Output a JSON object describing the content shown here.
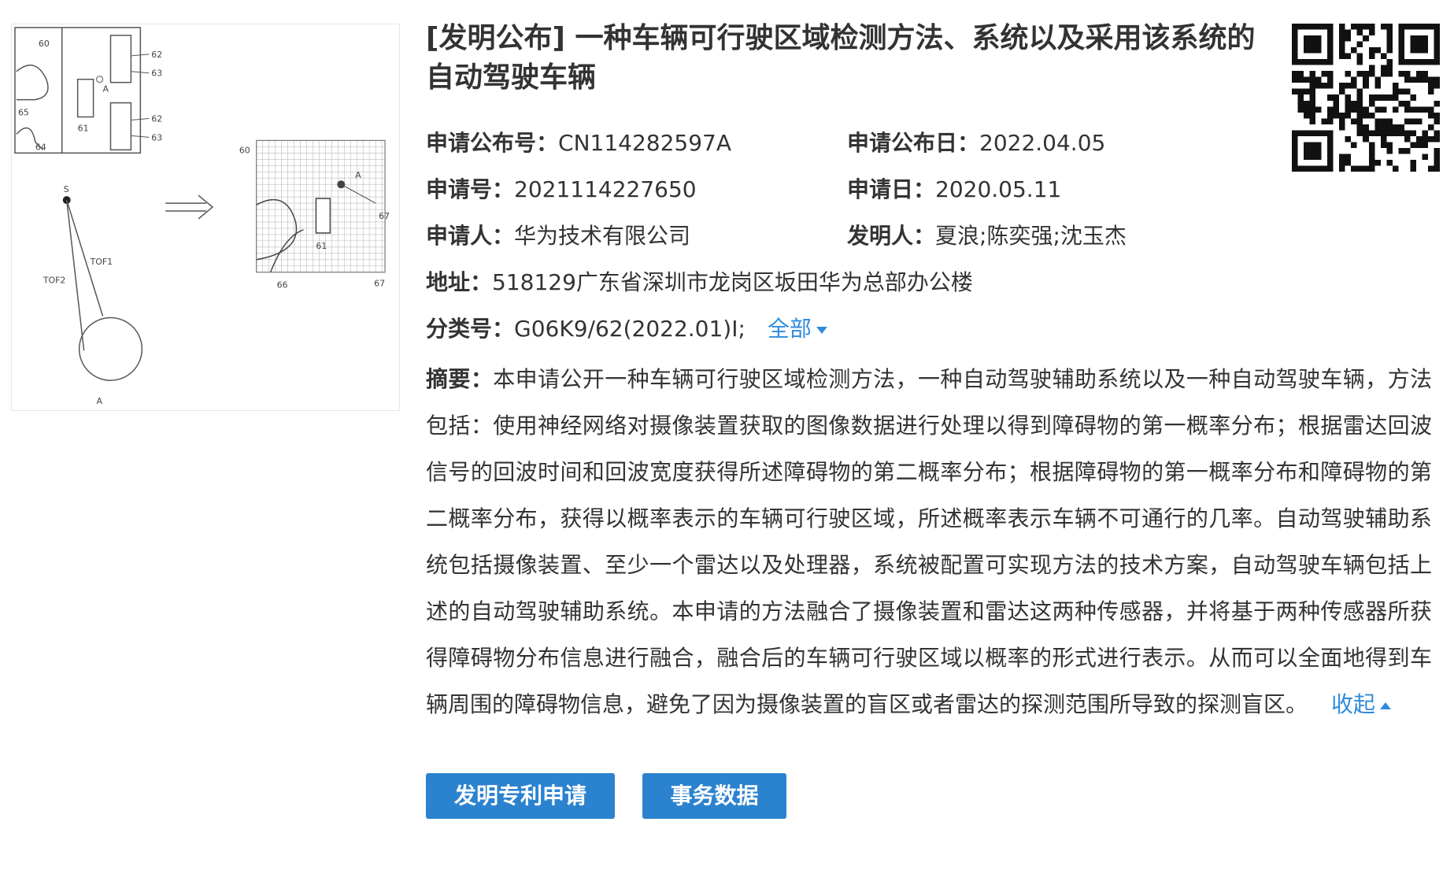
{
  "patent": {
    "title": "[发明公布] 一种车辆可行驶区域检测方法、系统以及采用该系统的自动驾驶车辆",
    "pub_no_label": "申请公布号：",
    "pub_no": "CN114282597A",
    "pub_date_label": "申请公布日：",
    "pub_date": "2022.04.05",
    "app_no_label": "申请号：",
    "app_no": "2021114227650",
    "app_date_label": "申请日：",
    "app_date": "2020.05.11",
    "applicant_label": "申请人：",
    "applicant": "华为技术有限公司",
    "inventor_label": "发明人：",
    "inventor": "夏浪;陈奕强;沈玉杰",
    "address_label": "地址：",
    "address": "518129广东省深圳市龙岗区坂田华为总部办公楼",
    "class_label": "分类号：",
    "class_value": "G06K9/62(2022.01)I;",
    "class_more": "全部",
    "abstract_label": "摘要：",
    "abstract": "本申请公开一种车辆可行驶区域检测方法，一种自动驾驶辅助系统以及一种自动驾驶车辆，方法包括：使用神经网络对摄像装置获取的图像数据进行处理以得到障碍物的第一概率分布；根据雷达回波信号的回波时间和回波宽度获得所述障碍物的第二概率分布；根据障碍物的第一概率分布和障碍物的第二概率分布，获得以概率表示的车辆可行驶区域，所述概率表示车辆不可通行的几率。自动驾驶辅助系统包括摄像装置、至少一个雷达以及处理器，系统被配置可实现方法的技术方案，自动驾驶车辆包括上述的自动驾驶辅助系统。本申请的方法融合了摄像装置和雷达这两种传感器，并将基于两种传感器所获得障碍物分布信息进行融合，融合后的车辆可行驶区域以概率的形式进行表示。从而可以全面地得到车辆周围的障碍物信息，避免了因为摄像装置的盲区或者雷达的探测范围所导致的探测盲区。",
    "collapse": "收起"
  },
  "buttons": {
    "apply": "发明专利申请",
    "affairs": "事务数据"
  },
  "drawing_labels": {
    "l60": "60",
    "l62a": "62",
    "l63a": "63",
    "l65": "65",
    "l61a": "61",
    "l62b": "62",
    "l63b": "63",
    "l64": "64",
    "lA1": "A",
    "lS": "S",
    "tof1": "TOF1",
    "tof2": "TOF2",
    "lA2": "A",
    "r60": "60",
    "rA": "A",
    "r67a": "67",
    "r61": "61",
    "r66": "66",
    "r67b": "67"
  },
  "colors": {
    "link": "#2f8cdb",
    "button": "#2b83cf",
    "text": "#333333"
  },
  "icons": {
    "more": "caret-down-icon",
    "collapse": "caret-up-icon"
  }
}
